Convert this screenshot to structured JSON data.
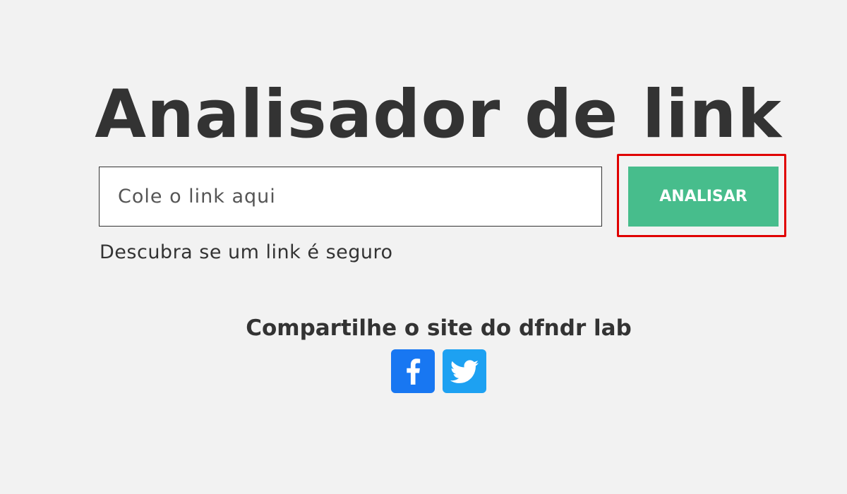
{
  "header": {
    "title": "Analisador de link"
  },
  "form": {
    "input_placeholder": "Cole o link aqui",
    "input_value": "",
    "button_label": "ANALISAR",
    "hint": "Descubra se um link é seguro"
  },
  "share": {
    "title": "Compartilhe o site do dfndr lab",
    "buttons": [
      {
        "icon": "facebook-icon",
        "color": "#1877f2"
      },
      {
        "icon": "twitter-icon",
        "color": "#1da1f2"
      }
    ]
  },
  "colors": {
    "background": "#f2f2f2",
    "text": "#333333",
    "accent": "#47bd8c",
    "highlight": "#e00000"
  }
}
